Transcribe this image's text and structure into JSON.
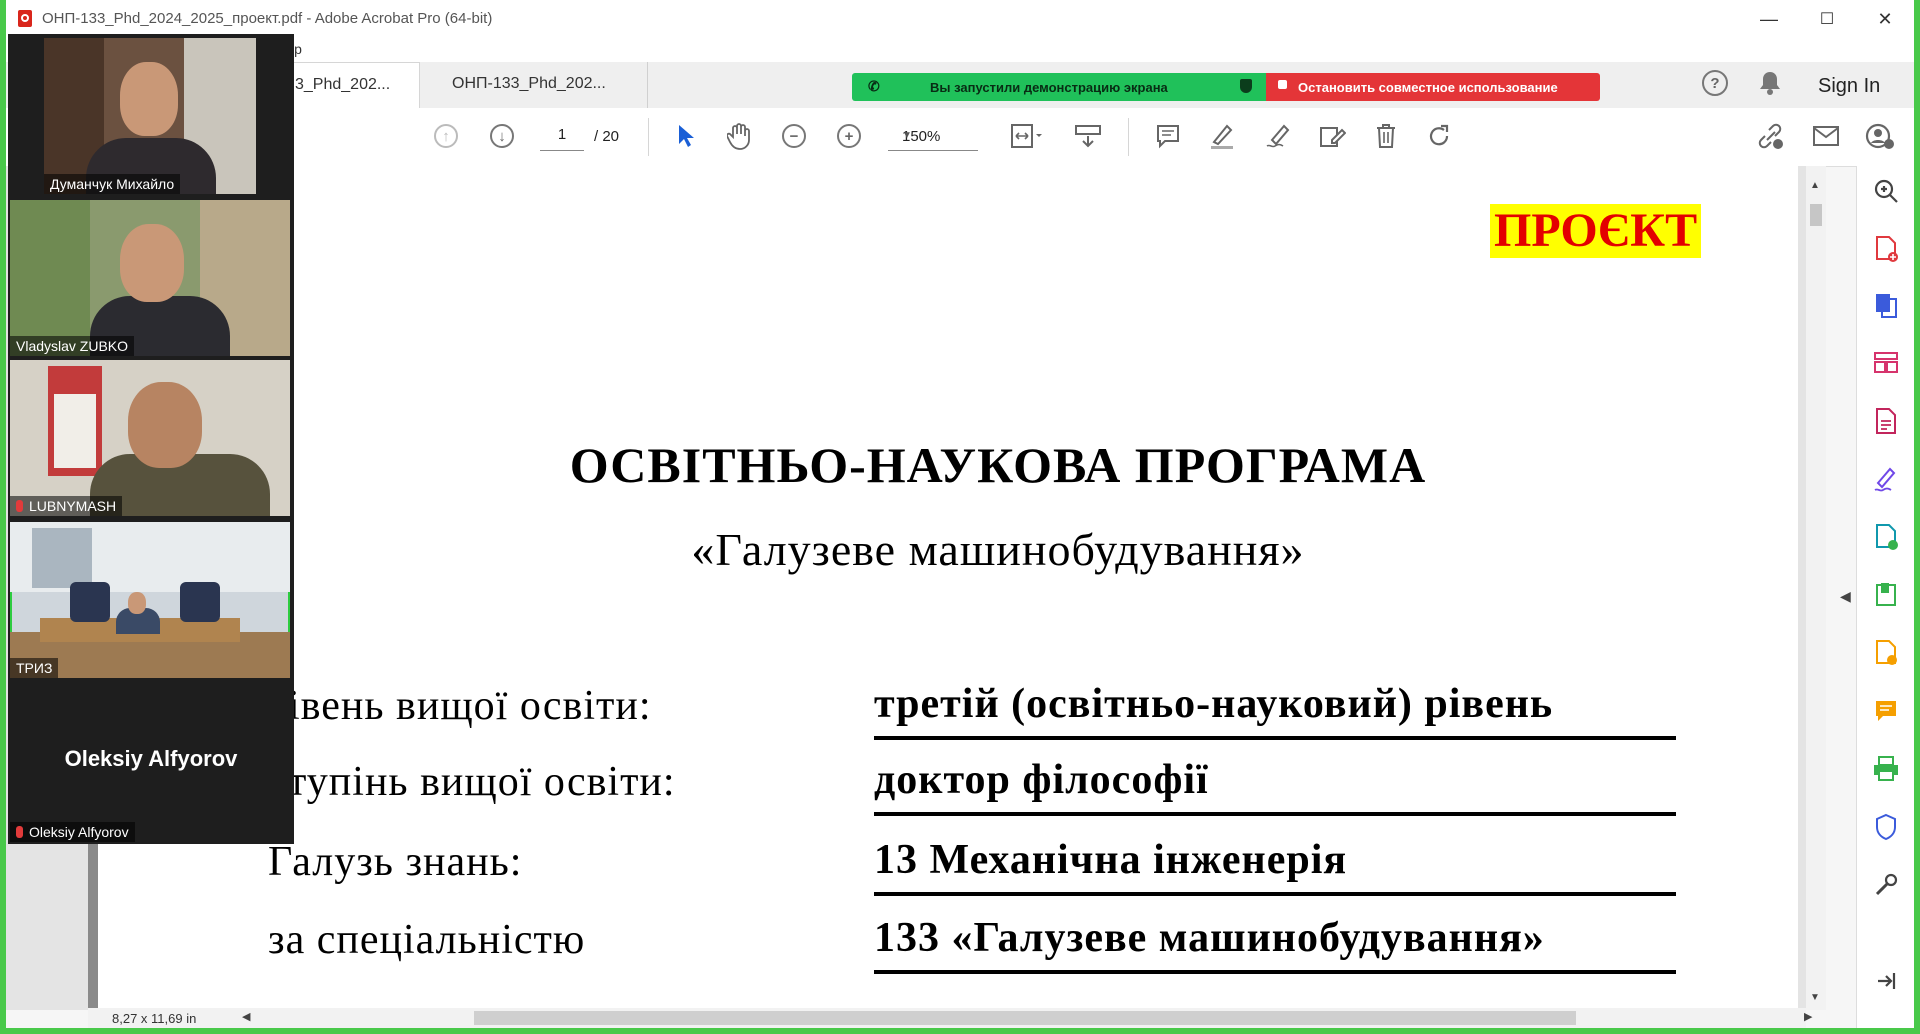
{
  "window": {
    "title": "ОНП-133_Phd_2024_2025_проект.pdf - Adobe Acrobat Pro (64-bit)",
    "minimize": "—",
    "maximize": "☐",
    "close": "✕"
  },
  "menubar": {
    "help_fragment": "lp"
  },
  "tabs": [
    {
      "label": "3_Phd_202..."
    },
    {
      "label": "ОНП-133_Phd_202..."
    }
  ],
  "share_banner": {
    "status": "Вы запустили демонстрацию экрана",
    "stop": "Остановить совместное использование",
    "status_color": "#20c15a",
    "stop_color": "#e43538"
  },
  "header": {
    "sign_in": "Sign In",
    "help_icon": "help-icon",
    "bell_icon": "bell-icon"
  },
  "toolbar": {
    "page_current": "1",
    "page_total": "/ 20",
    "zoom": "150%",
    "icons": [
      "prev-page-icon",
      "next-page-icon",
      "select-cursor-icon",
      "hand-icon",
      "zoom-out-icon",
      "zoom-in-icon",
      "fit-page-icon",
      "scroll-mode-icon",
      "comment-icon",
      "highlight-icon",
      "sign-icon",
      "edit-icon",
      "delete-icon",
      "rotate-icon",
      "link-icon",
      "mail-icon",
      "share-user-icon"
    ]
  },
  "document": {
    "stamp": "ПРОЄКТ",
    "stamp_bg": "#ffff00",
    "stamp_color": "#e30000",
    "title": "ОСВІТНЬО-НАУКОВА ПРОГРАМА",
    "subtitle": "«Галузеве машинобудування»",
    "rows": [
      {
        "label": "івень вищої освіти:",
        "value": "третій (освітньо-науковий) рівень"
      },
      {
        "label": "тупінь вищої освіти:",
        "value": "доктор філософії"
      },
      {
        "label": "Галузь знань:",
        "value": "13 Механічна інженерія"
      },
      {
        "label": "за спеціальністю",
        "value": "133 «Галузеве машинобудування»"
      }
    ]
  },
  "status": {
    "page_size": "8,27 x 11,69 in"
  },
  "right_tools": [
    "zoom-search-icon",
    "create-pdf-icon",
    "export-pdf-icon",
    "organize-pages-icon",
    "edit-pdf-icon",
    "fill-sign-icon",
    "combine-files-icon",
    "compress-icon",
    "send-review-icon",
    "comment-tool-icon",
    "print-icon",
    "protect-icon",
    "more-tools-icon",
    "expand-panel-icon"
  ],
  "participants": [
    {
      "name": "Думанчук Михайло",
      "muted": false
    },
    {
      "name": "Vladyslav ZUBKO",
      "muted": false
    },
    {
      "name": "LUBNYMASH",
      "muted": true
    },
    {
      "name": "ТРИЗ",
      "muted": false
    },
    {
      "name": "Oleksiy Alfyorov",
      "display": "Oleksiy Alfyorov",
      "muted": true
    }
  ]
}
